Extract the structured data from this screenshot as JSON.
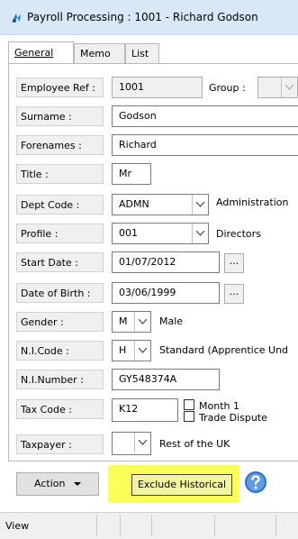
{
  "window": {
    "title": "Payroll Processing : 1001 - Richard Godson"
  },
  "tabs": [
    {
      "label": "General",
      "active": true
    },
    {
      "label": "Memo",
      "active": false
    },
    {
      "label": "List",
      "active": false
    }
  ],
  "fields": {
    "employee_ref": {
      "label": "Employee Ref :",
      "value": "1001"
    },
    "group": {
      "label": "Group :",
      "value": ""
    },
    "surname": {
      "label": "Surname :",
      "value": "Godson"
    },
    "forenames": {
      "label": "Forenames :",
      "value": "Richard"
    },
    "title": {
      "label": "Title :",
      "value": "Mr"
    },
    "dept_code": {
      "label": "Dept Code :",
      "value": "ADMN",
      "description": "Administration"
    },
    "profile": {
      "label": "Profile :",
      "value": "001",
      "description": "Directors"
    },
    "start_date": {
      "label": "Start Date :",
      "value": "01/07/2012"
    },
    "date_of_birth": {
      "label": "Date of Birth :",
      "value": "03/06/1999"
    },
    "gender": {
      "label": "Gender :",
      "value": "M",
      "description": "Male"
    },
    "ni_code": {
      "label": "N.I.Code :",
      "value": "H",
      "description": "Standard (Apprentice Und"
    },
    "ni_number": {
      "label": "N.I.Number :",
      "value": "GY548374A"
    },
    "tax_code": {
      "label": "Tax Code :",
      "value": "K12",
      "month1_label": "Month 1",
      "month1_checked": false,
      "trade_dispute_label": "Trade Dispute",
      "trade_dispute_checked": false
    },
    "taxpayer": {
      "label": "Taxpayer :",
      "value": "",
      "description": "Rest of the UK"
    }
  },
  "ellipsis": "...",
  "buttons": {
    "action": "Action",
    "exclude_historical": "Exclude Historical"
  },
  "status": {
    "text": "View"
  },
  "colors": {
    "highlight": "#fbff5a",
    "titlebar": "#d8e8f6"
  }
}
